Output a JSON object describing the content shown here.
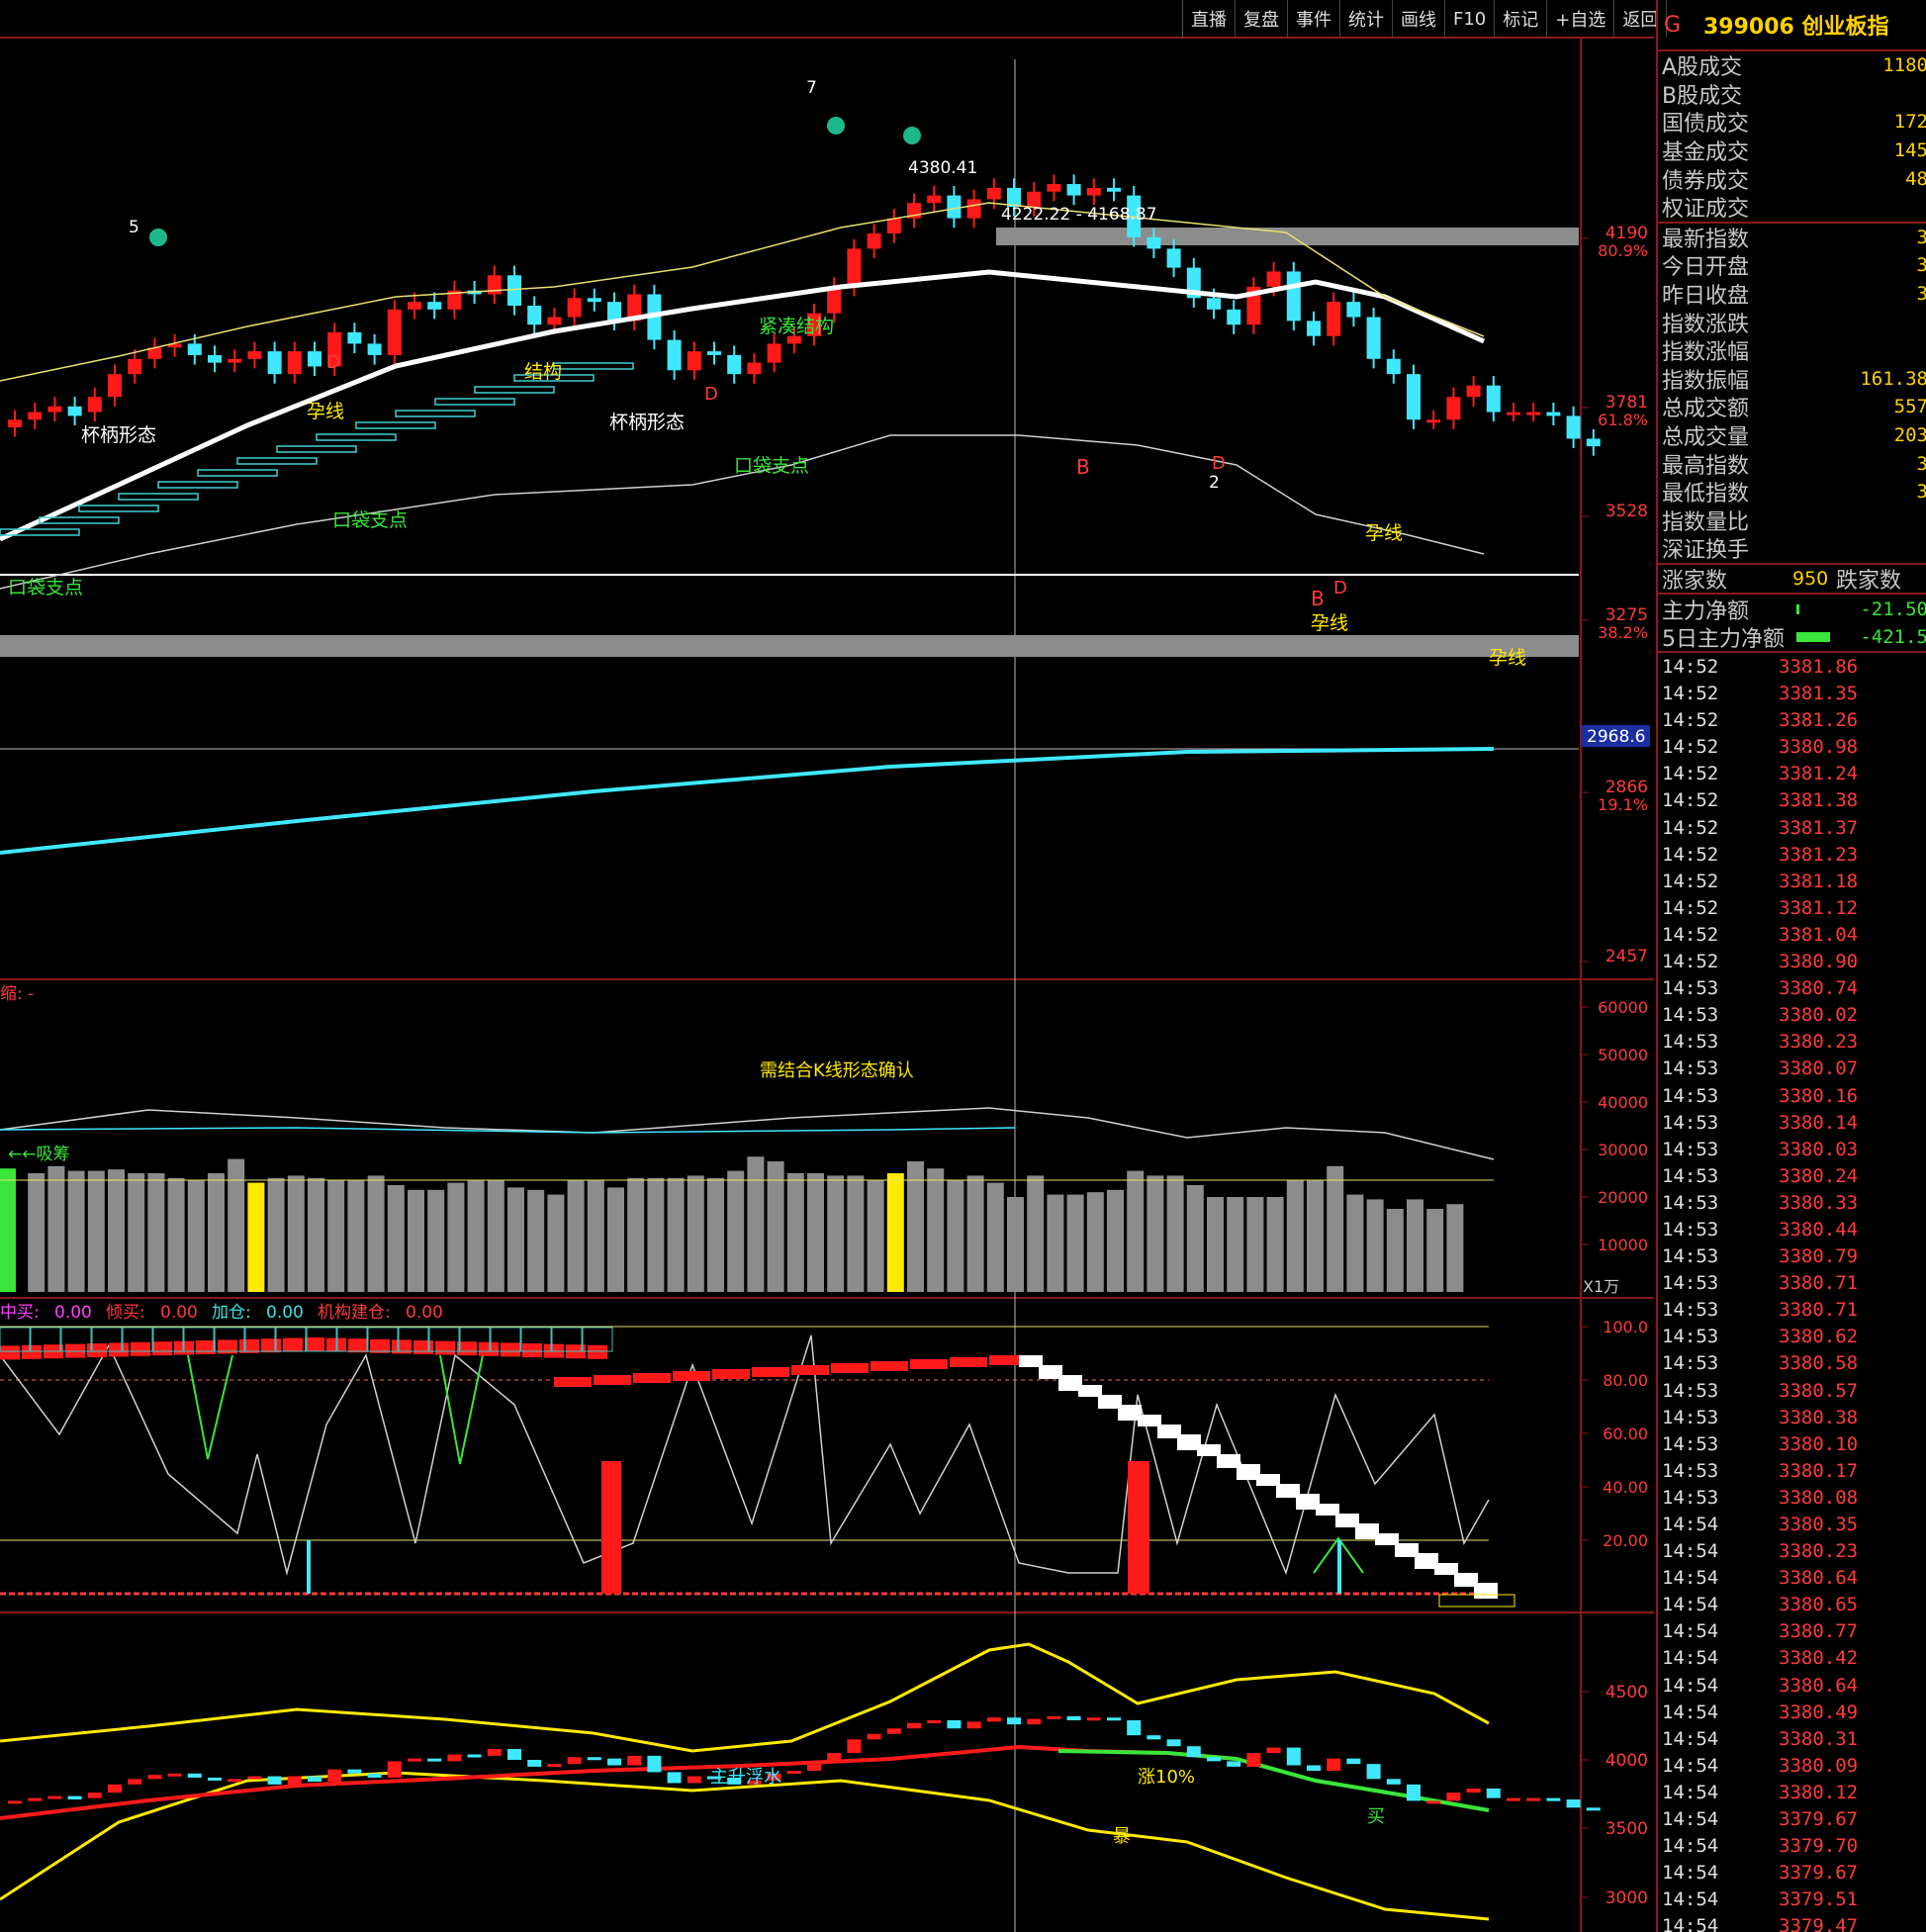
{
  "toolbar": {
    "items": [
      "直播",
      "复盘",
      "事件",
      "统计",
      "画线",
      "F10",
      "标记",
      "+自选",
      "返回"
    ]
  },
  "header": {
    "flag": "G",
    "code_name": "399006 创业板指"
  },
  "info_panel": {
    "block1": [
      {
        "label": "A股成交",
        "value": "1180"
      },
      {
        "label": "B股成交",
        "value": ""
      },
      {
        "label": "国债成交",
        "value": "172"
      },
      {
        "label": "基金成交",
        "value": "145"
      },
      {
        "label": "债券成交",
        "value": "48"
      },
      {
        "label": "权证成交",
        "value": ""
      }
    ],
    "block2": [
      {
        "label": "最新指数",
        "value": "3"
      },
      {
        "label": "今日开盘",
        "value": "3"
      },
      {
        "label": "昨日收盘",
        "value": "3"
      },
      {
        "label": "指数涨跌",
        "value": ""
      },
      {
        "label": "指数涨幅",
        "value": ""
      },
      {
        "label": "指数振幅",
        "value": "161.38"
      },
      {
        "label": "总成交额",
        "value": "557"
      },
      {
        "label": "总成交量",
        "value": "203"
      },
      {
        "label": "最高指数",
        "value": "3"
      },
      {
        "label": "最低指数",
        "value": "3"
      },
      {
        "label": "指数量比",
        "value": ""
      },
      {
        "label": "深证换手",
        "value": ""
      }
    ],
    "breadth": {
      "up_label": "涨家数",
      "up_value": "950",
      "down_label": "跌家数"
    },
    "flows": [
      {
        "label": "主力净额",
        "value": "-21.50"
      },
      {
        "label": "5日主力净额",
        "value": "-421.5"
      }
    ]
  },
  "ticks": [
    [
      "14:52",
      "3381.86"
    ],
    [
      "14:52",
      "3381.35"
    ],
    [
      "14:52",
      "3381.26"
    ],
    [
      "14:52",
      "3380.98"
    ],
    [
      "14:52",
      "3381.24"
    ],
    [
      "14:52",
      "3381.38"
    ],
    [
      "14:52",
      "3381.37"
    ],
    [
      "14:52",
      "3381.23"
    ],
    [
      "14:52",
      "3381.18"
    ],
    [
      "14:52",
      "3381.12"
    ],
    [
      "14:52",
      "3381.04"
    ],
    [
      "14:52",
      "3380.90"
    ],
    [
      "14:53",
      "3380.74"
    ],
    [
      "14:53",
      "3380.02"
    ],
    [
      "14:53",
      "3380.23"
    ],
    [
      "14:53",
      "3380.07"
    ],
    [
      "14:53",
      "3380.16"
    ],
    [
      "14:53",
      "3380.14"
    ],
    [
      "14:53",
      "3380.03"
    ],
    [
      "14:53",
      "3380.24"
    ],
    [
      "14:53",
      "3380.33"
    ],
    [
      "14:53",
      "3380.44"
    ],
    [
      "14:53",
      "3380.79"
    ],
    [
      "14:53",
      "3380.71"
    ],
    [
      "14:53",
      "3380.71"
    ],
    [
      "14:53",
      "3380.62"
    ],
    [
      "14:53",
      "3380.58"
    ],
    [
      "14:53",
      "3380.57"
    ],
    [
      "14:53",
      "3380.38"
    ],
    [
      "14:53",
      "3380.10"
    ],
    [
      "14:53",
      "3380.17"
    ],
    [
      "14:53",
      "3380.08"
    ],
    [
      "14:54",
      "3380.35"
    ],
    [
      "14:54",
      "3380.23"
    ],
    [
      "14:54",
      "3380.64"
    ],
    [
      "14:54",
      "3380.65"
    ],
    [
      "14:54",
      "3380.77"
    ],
    [
      "14:54",
      "3380.42"
    ],
    [
      "14:54",
      "3380.64"
    ],
    [
      "14:54",
      "3380.49"
    ],
    [
      "14:54",
      "3380.31"
    ],
    [
      "14:54",
      "3380.09"
    ],
    [
      "14:54",
      "3380.12"
    ],
    [
      "14:54",
      "3379.67"
    ],
    [
      "14:54",
      "3379.70"
    ],
    [
      "14:54",
      "3379.67"
    ],
    [
      "14:54",
      "3379.51"
    ],
    [
      "14:54",
      "3379.47"
    ]
  ],
  "main_axis": {
    "ticks": [
      {
        "price": "4190",
        "pct": "80.9%"
      },
      {
        "price": "3781",
        "pct": "61.8%"
      },
      {
        "price": "3528",
        "pct": ""
      },
      {
        "price": "3275",
        "pct": "38.2%"
      },
      {
        "price": "2866",
        "pct": "19.1%"
      },
      {
        "price": "2457",
        "pct": ""
      }
    ],
    "current_box": "2968.6"
  },
  "main_annotations": {
    "range_label": "4222.22 - 4168.87",
    "peak_label": "4380.41",
    "texts": [
      "杯柄形态",
      "杯柄形态",
      "口袋支点",
      "口袋支点",
      "口袋支点",
      "紧凑结构",
      "结构",
      "孕线",
      "孕线",
      "孕线",
      "孕线"
    ],
    "wave_numbers": [
      "5",
      "7",
      "2"
    ]
  },
  "volume_panel": {
    "header": "缩: -",
    "note": "需结合K线形态确认",
    "left_tag": "←←吸筹",
    "ticks": [
      "60000",
      "50000",
      "40000",
      "30000",
      "20000",
      "10000"
    ],
    "unit": "X1万"
  },
  "osc_panel": {
    "legend": [
      {
        "label": "中买:",
        "value": "0.00",
        "color": "#ff40ff"
      },
      {
        "label": "倾买:",
        "value": "0.00",
        "color": "#ff3b3b"
      },
      {
        "label": "加仓:",
        "value": "0.00",
        "color": "#40e0e0"
      },
      {
        "label": "机构建仓:",
        "value": "0.00",
        "color": "#ff3b3b"
      }
    ],
    "ticks": [
      "100.0",
      "80.00",
      "60.00",
      "40.00",
      "20.00"
    ]
  },
  "band_panel": {
    "ticks": [
      "4500",
      "4000",
      "3500",
      "3000"
    ],
    "texts": [
      "主升浮水",
      "涨10%",
      "暴",
      "买"
    ]
  },
  "colors": {
    "up": "#ff1a1a",
    "down": "#40e8ff",
    "yellow": "#ffea00",
    "magenta": "#ff40ff",
    "grid_red": "#8a1a1a"
  },
  "chart_data": {
    "type": "candlestick",
    "closes": [
      3700,
      3720,
      3735,
      3710,
      3760,
      3820,
      3860,
      3890,
      3900,
      3870,
      3850,
      3860,
      3880,
      3820,
      3880,
      3840,
      3930,
      3900,
      3870,
      3990,
      4010,
      3990,
      4040,
      4030,
      4080,
      4000,
      3950,
      3970,
      4020,
      4010,
      3960,
      4030,
      3910,
      3830,
      3880,
      3870,
      3820,
      3850,
      3900,
      3920,
      3980,
      4050,
      4150,
      4190,
      4230,
      4270,
      4290,
      4230,
      4280,
      4310,
      4260,
      4300,
      4320,
      4290,
      4310,
      4300,
      4180,
      4150,
      4100,
      4020,
      3990,
      3950,
      4050,
      4090,
      3960,
      3920,
      4010,
      3970,
      3860,
      3820,
      3700,
      3700,
      3760,
      3790,
      3720,
      3720,
      3720,
      3710,
      3650,
      3630
    ],
    "opens": [
      3680,
      3700,
      3720,
      3735,
      3720,
      3760,
      3820,
      3860,
      3890,
      3900,
      3870,
      3850,
      3860,
      3880,
      3820,
      3880,
      3840,
      3930,
      3900,
      3870,
      3990,
      4010,
      3990,
      4040,
      4030,
      4080,
      4000,
      3950,
      3970,
      4020,
      4010,
      3960,
      4030,
      3910,
      3830,
      3880,
      3870,
      3820,
      3850,
      3900,
      3920,
      3980,
      4050,
      4150,
      4190,
      4230,
      4270,
      4290,
      4230,
      4280,
      4310,
      4260,
      4300,
      4320,
      4290,
      4310,
      4290,
      4180,
      4150,
      4100,
      4020,
      3990,
      3950,
      4050,
      4090,
      3960,
      3920,
      4010,
      3970,
      3860,
      3820,
      3700,
      3700,
      3760,
      3790,
      3720,
      3720,
      3720,
      3710,
      3650
    ],
    "volumes": [
      26000,
      25000,
      26500,
      25500,
      25500,
      25800,
      25000,
      25000,
      24000,
      23500,
      25000,
      28000,
      23000,
      24000,
      24500,
      24000,
      23500,
      23500,
      24500,
      22500,
      21500,
      21500,
      23000,
      23500,
      23500,
      22000,
      21500,
      20500,
      23500,
      23500,
      22000,
      24000,
      24000,
      24000,
      24500,
      24000,
      25500,
      28500,
      27500,
      25000,
      25000,
      24500,
      24500,
      23500,
      25000,
      27500,
      26000,
      23500,
      24500,
      23000,
      20000,
      24500,
      20500,
      20500,
      21000,
      21500,
      25500,
      24500,
      24500,
      22500,
      20000,
      20000,
      20000,
      20000,
      23500,
      23500,
      26500,
      20500,
      19500,
      17500,
      19500,
      17500,
      18500
    ]
  }
}
